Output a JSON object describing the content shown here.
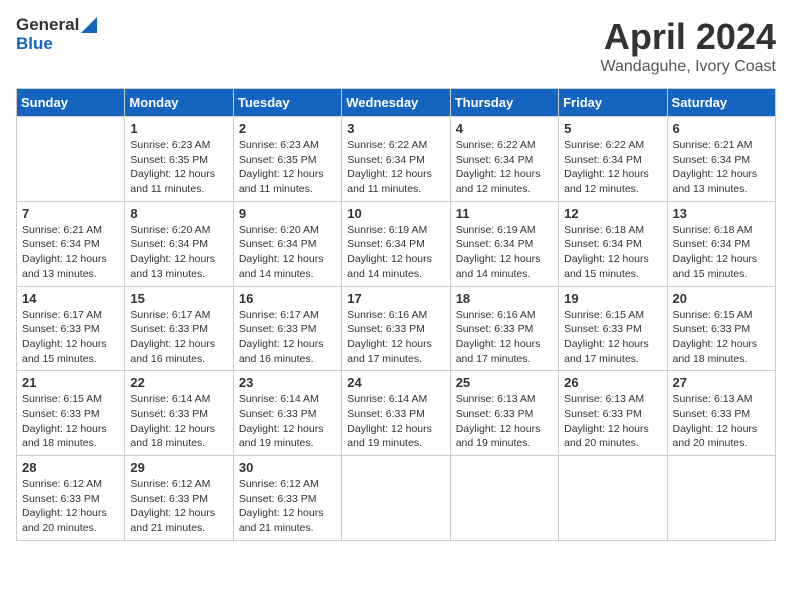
{
  "logo": {
    "general": "General",
    "blue": "Blue"
  },
  "header": {
    "month": "April 2024",
    "location": "Wandaguhe, Ivory Coast"
  },
  "weekdays": [
    "Sunday",
    "Monday",
    "Tuesday",
    "Wednesday",
    "Thursday",
    "Friday",
    "Saturday"
  ],
  "weeks": [
    [
      {
        "day": "",
        "info": ""
      },
      {
        "day": "1",
        "info": "Sunrise: 6:23 AM\nSunset: 6:35 PM\nDaylight: 12 hours\nand 11 minutes."
      },
      {
        "day": "2",
        "info": "Sunrise: 6:23 AM\nSunset: 6:35 PM\nDaylight: 12 hours\nand 11 minutes."
      },
      {
        "day": "3",
        "info": "Sunrise: 6:22 AM\nSunset: 6:34 PM\nDaylight: 12 hours\nand 11 minutes."
      },
      {
        "day": "4",
        "info": "Sunrise: 6:22 AM\nSunset: 6:34 PM\nDaylight: 12 hours\nand 12 minutes."
      },
      {
        "day": "5",
        "info": "Sunrise: 6:22 AM\nSunset: 6:34 PM\nDaylight: 12 hours\nand 12 minutes."
      },
      {
        "day": "6",
        "info": "Sunrise: 6:21 AM\nSunset: 6:34 PM\nDaylight: 12 hours\nand 13 minutes."
      }
    ],
    [
      {
        "day": "7",
        "info": "Sunrise: 6:21 AM\nSunset: 6:34 PM\nDaylight: 12 hours\nand 13 minutes."
      },
      {
        "day": "8",
        "info": "Sunrise: 6:20 AM\nSunset: 6:34 PM\nDaylight: 12 hours\nand 13 minutes."
      },
      {
        "day": "9",
        "info": "Sunrise: 6:20 AM\nSunset: 6:34 PM\nDaylight: 12 hours\nand 14 minutes."
      },
      {
        "day": "10",
        "info": "Sunrise: 6:19 AM\nSunset: 6:34 PM\nDaylight: 12 hours\nand 14 minutes."
      },
      {
        "day": "11",
        "info": "Sunrise: 6:19 AM\nSunset: 6:34 PM\nDaylight: 12 hours\nand 14 minutes."
      },
      {
        "day": "12",
        "info": "Sunrise: 6:18 AM\nSunset: 6:34 PM\nDaylight: 12 hours\nand 15 minutes."
      },
      {
        "day": "13",
        "info": "Sunrise: 6:18 AM\nSunset: 6:34 PM\nDaylight: 12 hours\nand 15 minutes."
      }
    ],
    [
      {
        "day": "14",
        "info": "Sunrise: 6:17 AM\nSunset: 6:33 PM\nDaylight: 12 hours\nand 15 minutes."
      },
      {
        "day": "15",
        "info": "Sunrise: 6:17 AM\nSunset: 6:33 PM\nDaylight: 12 hours\nand 16 minutes."
      },
      {
        "day": "16",
        "info": "Sunrise: 6:17 AM\nSunset: 6:33 PM\nDaylight: 12 hours\nand 16 minutes."
      },
      {
        "day": "17",
        "info": "Sunrise: 6:16 AM\nSunset: 6:33 PM\nDaylight: 12 hours\nand 17 minutes."
      },
      {
        "day": "18",
        "info": "Sunrise: 6:16 AM\nSunset: 6:33 PM\nDaylight: 12 hours\nand 17 minutes."
      },
      {
        "day": "19",
        "info": "Sunrise: 6:15 AM\nSunset: 6:33 PM\nDaylight: 12 hours\nand 17 minutes."
      },
      {
        "day": "20",
        "info": "Sunrise: 6:15 AM\nSunset: 6:33 PM\nDaylight: 12 hours\nand 18 minutes."
      }
    ],
    [
      {
        "day": "21",
        "info": "Sunrise: 6:15 AM\nSunset: 6:33 PM\nDaylight: 12 hours\nand 18 minutes."
      },
      {
        "day": "22",
        "info": "Sunrise: 6:14 AM\nSunset: 6:33 PM\nDaylight: 12 hours\nand 18 minutes."
      },
      {
        "day": "23",
        "info": "Sunrise: 6:14 AM\nSunset: 6:33 PM\nDaylight: 12 hours\nand 19 minutes."
      },
      {
        "day": "24",
        "info": "Sunrise: 6:14 AM\nSunset: 6:33 PM\nDaylight: 12 hours\nand 19 minutes."
      },
      {
        "day": "25",
        "info": "Sunrise: 6:13 AM\nSunset: 6:33 PM\nDaylight: 12 hours\nand 19 minutes."
      },
      {
        "day": "26",
        "info": "Sunrise: 6:13 AM\nSunset: 6:33 PM\nDaylight: 12 hours\nand 20 minutes."
      },
      {
        "day": "27",
        "info": "Sunrise: 6:13 AM\nSunset: 6:33 PM\nDaylight: 12 hours\nand 20 minutes."
      }
    ],
    [
      {
        "day": "28",
        "info": "Sunrise: 6:12 AM\nSunset: 6:33 PM\nDaylight: 12 hours\nand 20 minutes."
      },
      {
        "day": "29",
        "info": "Sunrise: 6:12 AM\nSunset: 6:33 PM\nDaylight: 12 hours\nand 21 minutes."
      },
      {
        "day": "30",
        "info": "Sunrise: 6:12 AM\nSunset: 6:33 PM\nDaylight: 12 hours\nand 21 minutes."
      },
      {
        "day": "",
        "info": ""
      },
      {
        "day": "",
        "info": ""
      },
      {
        "day": "",
        "info": ""
      },
      {
        "day": "",
        "info": ""
      }
    ]
  ]
}
